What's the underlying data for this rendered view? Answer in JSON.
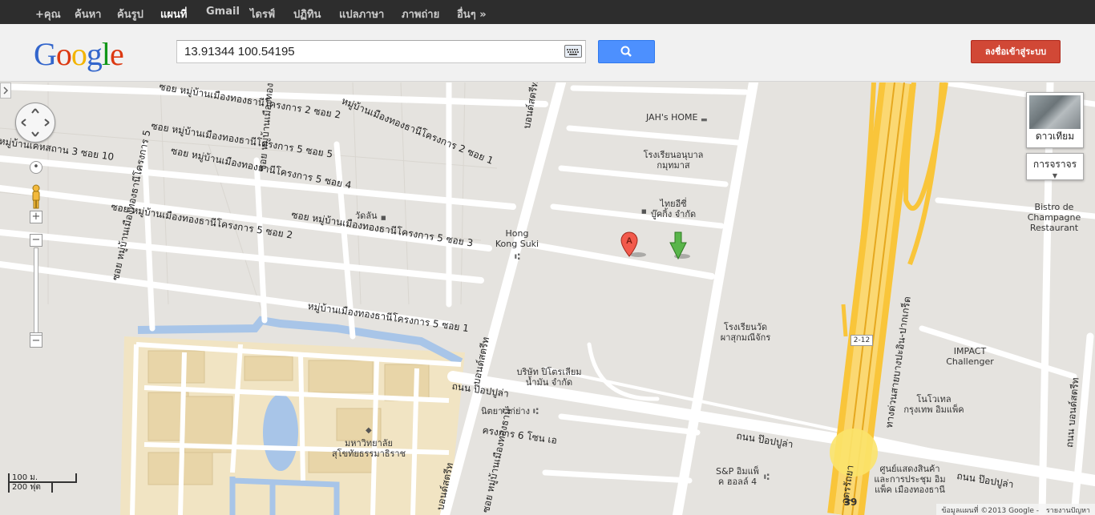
{
  "nav": {
    "items": [
      "+คุณ",
      "ค้นหา",
      "ค้นรูป",
      "แผนที่",
      "Gmail",
      "ไดรฟ์",
      "ปฏิทิน",
      "แปลภาษา",
      "ภาพถ่าย",
      "อื่นๆ »"
    ],
    "active_index": 3
  },
  "logo": {
    "text": "Google"
  },
  "search": {
    "value": "13.91344 100.54195"
  },
  "signin_label": "ลงชื่อเข้าสู่ระบบ",
  "layers": {
    "satellite": "ดาวเทียม",
    "traffic": "การจราจร"
  },
  "scale": {
    "metric": "100 ม.",
    "imperial": "200 ฟุต"
  },
  "attribution": {
    "text": "ข้อมูลแผนที่ ©2013 Google -",
    "report": "รายงานปัญหา"
  },
  "marker": {
    "letter": "A"
  },
  "places": {
    "jahs_home": "JAH's HOME",
    "kindergarten_1": "โรงเรียนอนุบาล",
    "kindergarten_2": "กมุทมาส",
    "thai_1": "ไทยอีซี่",
    "thai_2": "บู๊คกิ้ง จำกัด",
    "wat": "วัดลัน",
    "hongkong_1": "Hong",
    "hongkong_2": "Kong Suki",
    "bistro_1": "Bistro de",
    "bistro_2": "Champagne",
    "bistro_3": "Restaurant",
    "school_1": "โรงเรียนวัด",
    "school_2": "ผาสุกมณีจักร",
    "impact_1": "IMPACT",
    "impact_2": "Challenger",
    "petro_1": "บริษัท ปิโตรเลียม",
    "petro_2": "น้ำมัน จำกัด",
    "chicken": "นิตยา ไก่ย่าง",
    "univ_1": "มหาวิทยาลัย",
    "univ_2": "สุโขทัยธรรมาธิราช",
    "novotel_1": "โนโวเทล",
    "novotel_2": "กรุงเทพ อิมแพ็ค",
    "snp_1": "S&P อิมแพ็",
    "snp_2": "ค ฮอลล์ 4",
    "exhib_1": "ศูนย์แสดงสินค้า",
    "exhib_2": "และการประชุม อิม",
    "exhib_3": "แพ็ค เมืองทองธานี",
    "shield_212": "2-12",
    "shield_39": "39"
  },
  "roads": {
    "r1": "ซอย หมู่บ้านเมืองทองธานีโครงการ 2 ซอย 2",
    "r2": "ซอย หมู่บ้านเมืองทองธานีโครงการ 5 ซอย 5",
    "r3": "หมู่บ้านเมืองทองธานีโครงการ 2 ซอย 1",
    "r4": "ซอย หมู่บ้านเมืองทองธานีโครงการ 5 ซอย 4",
    "r5": "หมู่บ้านเคหสถาน 3 ซอย 10",
    "r6": "ซอย หมู่บ้านเมืองทองธานีโครงการ 5 ซอย 3",
    "r7": "ซอย หมู่บ้านเมืองทองธานีโครงการ 5 ซอย 2",
    "r8": "ซอย หมู่บ้านเมืองทองธานีโครงการ 5",
    "r9": "หมู่บ้านเมืองทองธานีโครงการ 5 ซอย 1",
    "r10": "ซอย หมู่บ้านเมืองทองธานีโครงการ 5",
    "r11": "บอนด์สตรีท",
    "r12": "บอนด์สตรีท",
    "r13": "ถนน ป๊อปปูล่า",
    "r14": "ถนน ป๊อปปูล่า",
    "r15": "ถนน ป๊อปปูล่า",
    "r16": "ทางด่วนสายบางปะอิน-ปากเกร็ด",
    "r17": "อุดรรัถยา",
    "r18": "ถนน บอนด์สตรีท",
    "r19": "ครงการ 6 โซน เอ",
    "r20": "บอนด์สตรีท",
    "r21": "ซอย หมู่บ้านเมืองทองธานี"
  }
}
